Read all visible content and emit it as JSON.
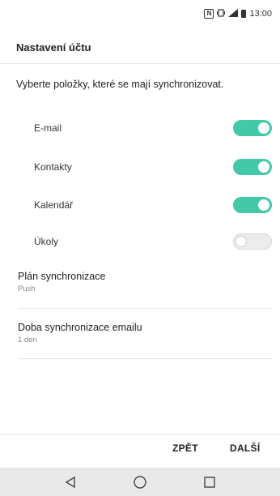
{
  "status_bar": {
    "time": "13:00",
    "icons": [
      "nfc-icon",
      "vibrate-icon",
      "signal-icon",
      "battery-icon"
    ]
  },
  "title": "Nastavení účtu",
  "instruction": "Vyberte položky, které se mají synchronizovat.",
  "sync_items": [
    {
      "label": "E-mail",
      "enabled": true
    },
    {
      "label": "Kontakty",
      "enabled": true
    },
    {
      "label": "Kalendář",
      "enabled": true
    },
    {
      "label": "Úkoly",
      "enabled": false
    }
  ],
  "settings": [
    {
      "title": "Plán synchronizace",
      "value": "Push"
    },
    {
      "title": "Doba synchronizace emailu",
      "value": "1 den"
    }
  ],
  "buttons": {
    "back": "ZPĚT",
    "next": "DALŠÍ"
  },
  "colors": {
    "toggle_on": "#43c8a8",
    "nav_bar": "#e9e9e9"
  }
}
